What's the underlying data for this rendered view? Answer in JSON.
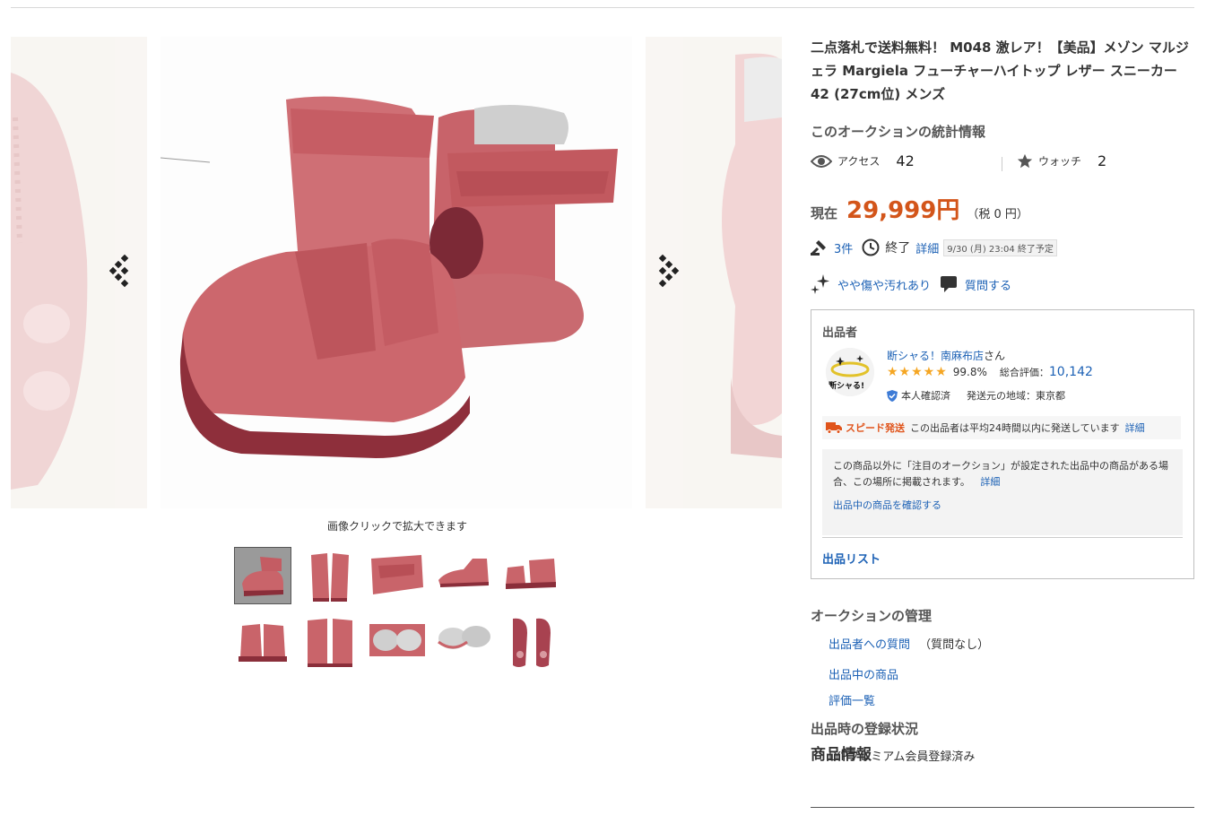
{
  "listing": {
    "title": "二点落札で送料無料！ M048 激レア！【美品】メゾン マルジェラ Margiela フューチャーハイトップ レザー スニーカー 42 (27cm位) メンズ"
  },
  "gallery": {
    "caption": "画像クリックで拡大できます",
    "thumbnails": [
      "thumb-1",
      "thumb-2",
      "thumb-3",
      "thumb-4",
      "thumb-5",
      "thumb-6",
      "thumb-7",
      "thumb-8",
      "thumb-9",
      "thumb-10"
    ]
  },
  "stats": {
    "heading": "このオークションの統計情報",
    "access_label": "アクセス",
    "access_value": "42",
    "watch_label": "ウォッチ",
    "watch_value": "2"
  },
  "price": {
    "label": "現在",
    "value": "29,999円",
    "tax": "（税 0 円）"
  },
  "meta": {
    "bids": "3件",
    "end_label": "終了",
    "detail_link": "詳細",
    "end_time": "9/30 (月) 23:04 終了予定"
  },
  "condition": {
    "label": "やや傷や汚れあり",
    "ask_question": "質問する"
  },
  "seller": {
    "heading": "出品者",
    "avatar_text": "断シャる!",
    "name": "断シャる！南麻布店",
    "name_suffix": "さん",
    "stars": "★★★★★",
    "percent": "99.8%",
    "total_label": "総合評価：",
    "total_value": "10,142",
    "verified": "本人確認済",
    "origin": "発送元の地域：東京都",
    "speed_label": "スピード発送",
    "speed_text": "この出品者は平均24時間以内に発送しています",
    "speed_detail": "詳細",
    "notice_text": "この商品以外に「注目のオークション」が設定された出品中の商品がある場合、この場所に掲載されます。",
    "notice_detail": "詳細",
    "notice_link": "出品中の商品を確認する",
    "list_link": "出品リスト"
  },
  "management": {
    "heading": "オークションの管理",
    "question_link": "出品者への質問",
    "question_note": "（質問なし）",
    "items_link": "出品中の商品",
    "ratings_link": "評価一覧"
  },
  "registration": {
    "heading": "出品時の登録状況",
    "value": "LYPプレミアム会員登録済み"
  },
  "product_info": {
    "heading": "商品情報"
  },
  "colors": {
    "price": "#d3551a",
    "link": "#1c61b5",
    "shoe": "#c9646a",
    "sole": "#8a2e3a",
    "star": "#f5a623"
  }
}
